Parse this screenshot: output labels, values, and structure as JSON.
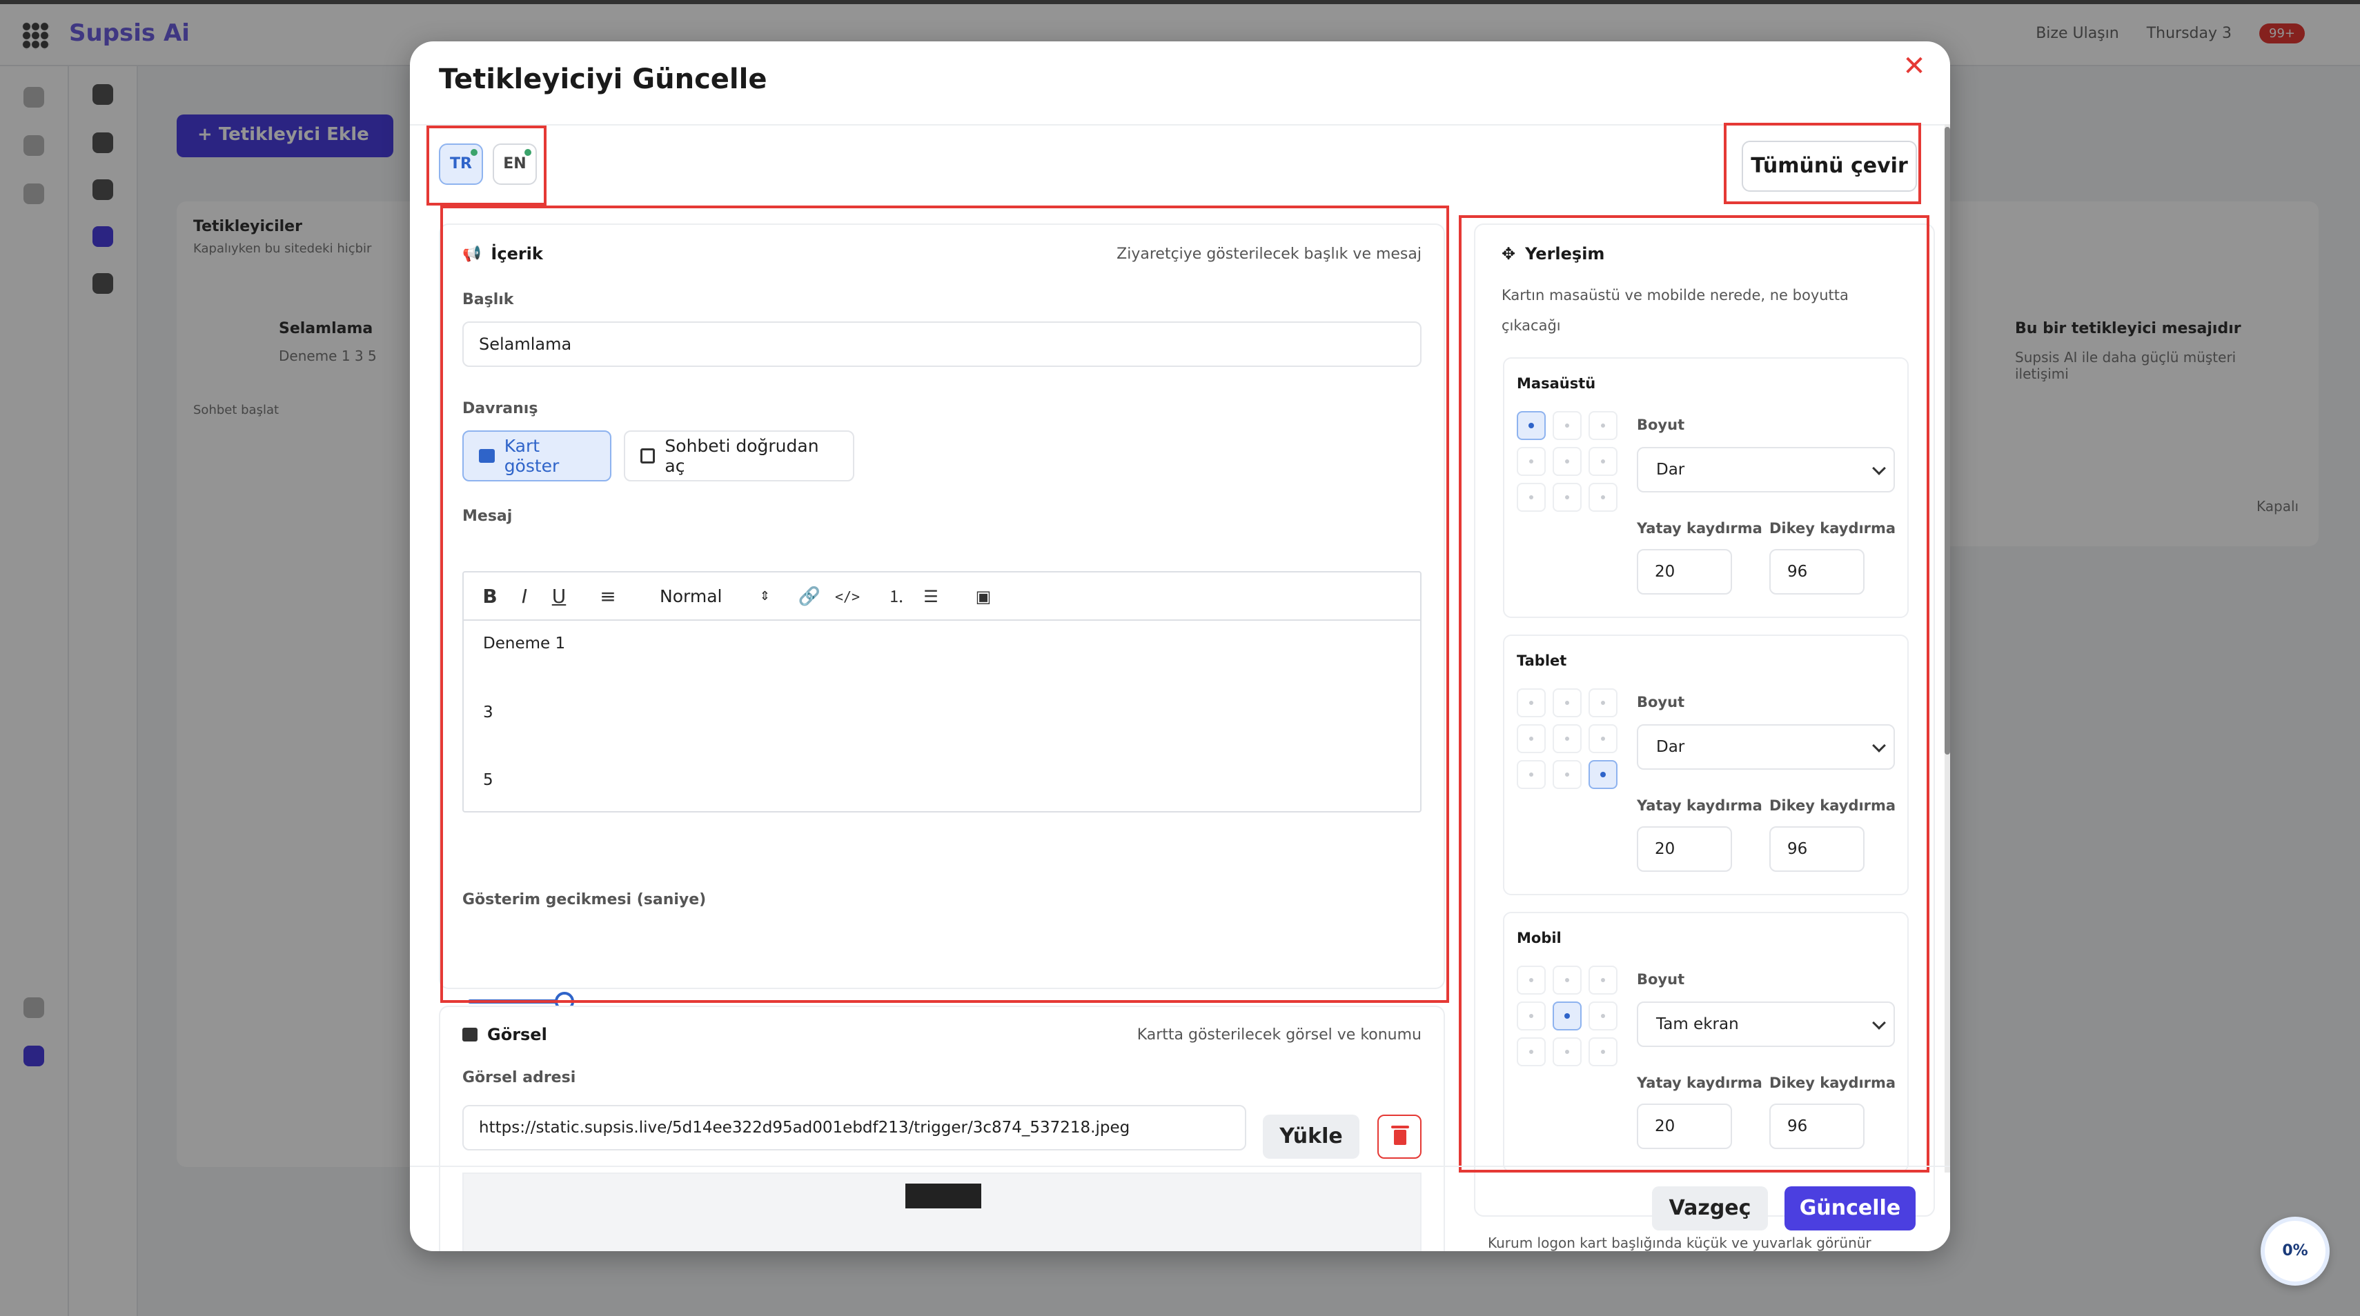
{
  "app": {
    "logo": "Supsis Ai",
    "bg_add_button": "+ Tetikleyici Ekle",
    "bg_panel_title": "Tetikleyiciler",
    "bg_panel_sub": "Kapalıyken bu sitedeki hiçbir",
    "bg_item_name": "Selamlama",
    "bg_item_desc": "Deneme 1 3 5",
    "bg_item_tag": "Sohbet başlat",
    "bg_right_title": "Bu bir tetikleyici mesajıdır",
    "bg_right_sub": "Supsis AI ile daha güçlü müşteri iletişimi",
    "bg_top_right": [
      "Bize Ulaşın",
      "Thursday 3"
    ],
    "bg_badge": "99+",
    "bg_toggle_label": "Kapalı"
  },
  "modal": {
    "title": "Tetikleyiciyi Güncelle",
    "languages": [
      {
        "code": "TR",
        "active": true
      },
      {
        "code": "EN",
        "active": false
      }
    ],
    "translate_all": "Tümünü çevir",
    "content": {
      "heading": "İçerik",
      "subtitle": "Ziyaretçiye gösterilecek başlık ve mesaj",
      "title_label": "Başlık",
      "title_value": "Selamlama",
      "behavior_label": "Davranış",
      "behavior_show_card": "Kart göster",
      "behavior_open_chat": "Sohbeti doğrudan aç",
      "message_label": "Mesaj",
      "format_select": "Normal",
      "message_lines": [
        "Deneme 1",
        "3",
        "5"
      ],
      "delay_label": "Gösterim gecikmesi (saniye)",
      "delay_fraction": 0.05
    },
    "image": {
      "heading": "Görsel",
      "subtitle": "Kartta gösterilecek görsel ve konumu",
      "url_label": "Görsel adresi",
      "url_value": "https://static.supsis.live/5d14ee322d95ad001ebdf213/trigger/3c874_537218.jpeg",
      "upload": "Yükle"
    },
    "layout": {
      "heading": "Yerleşim",
      "subtitle_1": "Kartın masaüstü ve mobilde nerede, ne boyutta",
      "subtitle_2": "çıkacağı",
      "size_label": "Boyut",
      "h_offset_label": "Yatay kaydırma",
      "v_offset_label": "Dikey kaydırma",
      "devices": [
        {
          "name": "Masaüstü",
          "selected_cell": 0,
          "size": "Dar",
          "h_offset": "20",
          "v_offset": "96"
        },
        {
          "name": "Tablet",
          "selected_cell": 8,
          "size": "Dar",
          "h_offset": "20",
          "v_offset": "96"
        },
        {
          "name": "Mobil",
          "selected_cell": 4,
          "size": "Tam ekran",
          "h_offset": "20",
          "v_offset": "96"
        }
      ]
    },
    "footer": {
      "cancel": "Vazgeç",
      "update": "Güncelle",
      "note": "Kurum logon kart başlığında küçük ve yuvarlak görünür"
    }
  },
  "progress_badge": "0%",
  "colors": {
    "accent": "#2f64c9",
    "primary_button": "#4b3fe0",
    "highlight": "#e53935"
  }
}
